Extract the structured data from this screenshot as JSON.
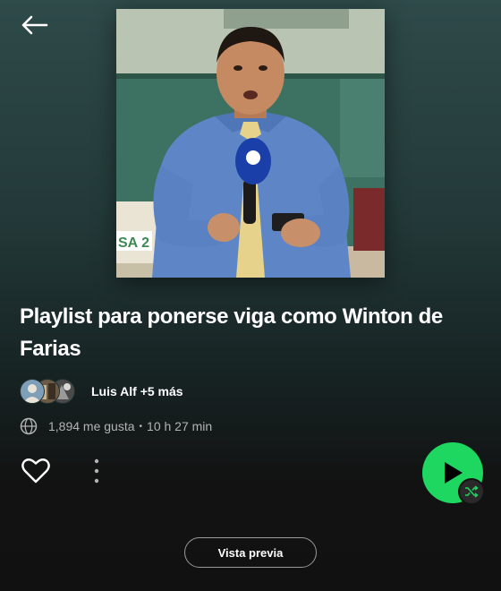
{
  "playlist": {
    "title": "Playlist para ponerse viga como Winton de Farias",
    "owners_text": "Luis Alf +5 más",
    "likes": "1,894 me gusta",
    "separator": "•",
    "duration": "10 h 27 min"
  },
  "cover": {
    "mic_brand_color": "#1a3fa8",
    "wall_color": "#3c6e5e",
    "sign_text": "SA 2"
  },
  "actions": {
    "preview_label": "Vista previa"
  },
  "colors": {
    "accent": "#1ed760",
    "secondary_text": "#b3b3b3"
  },
  "icons": [
    "back-arrow-icon",
    "globe-icon",
    "heart-icon",
    "more-options-icon",
    "play-icon",
    "shuffle-icon"
  ]
}
